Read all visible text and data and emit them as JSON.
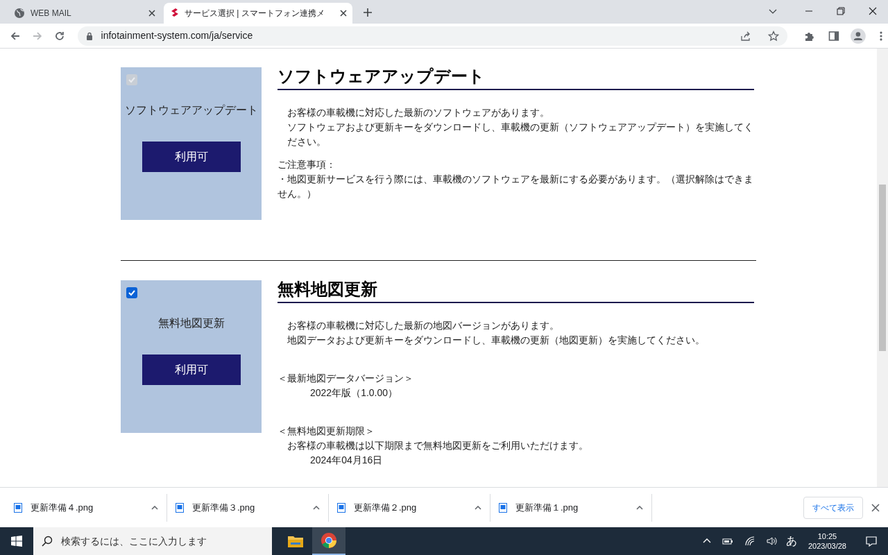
{
  "browser": {
    "tabs": [
      {
        "title": "WEB MAIL",
        "selected": false
      },
      {
        "title": "サービス選択 | スマートフォン連携メ",
        "selected": true
      }
    ],
    "url": "infotainment-system.com/ja/service"
  },
  "services": [
    {
      "card_label": "ソフトウェアアップデート",
      "checked": true,
      "disabled": true,
      "status_button": "利用可",
      "title": "ソフトウェアアップデート",
      "paragraphs": [
        [
          {
            "kind": "lead",
            "text": "お客様の車載機に対応した最新のソフトウェアがあります。"
          },
          {
            "kind": "lead",
            "text": "ソフトウェアおよび更新キーをダウンロードし、車載機の更新（ソフトウェアアップデート）を実施してください。"
          }
        ],
        [
          {
            "kind": "plain",
            "text": "ご注意事項："
          },
          {
            "kind": "plain",
            "text": "・地図更新サービスを行う際には、車載機のソフトウェアを最新にする必要があります。（選択解除はできません。）"
          }
        ]
      ]
    },
    {
      "card_label": "無料地図更新",
      "checked": true,
      "disabled": false,
      "status_button": "利用可",
      "title": "無料地図更新",
      "paragraphs": [
        [
          {
            "kind": "lead",
            "text": "お客様の車載機に対応した最新の地図バージョンがあります。"
          },
          {
            "kind": "lead",
            "text": "地図データおよび更新キーをダウンロードし、車載機の更新（地図更新）を実施してください。"
          }
        ],
        [
          {
            "kind": "plain",
            "text": "＜最新地図データバージョン＞"
          },
          {
            "kind": "value",
            "text": "2022年版（1.0.00）"
          }
        ],
        [
          {
            "kind": "plain",
            "text": "＜無料地図更新期限＞"
          },
          {
            "kind": "lead",
            "text": "お客様の車載機は以下期限まで無料地図更新をご利用いただけます。"
          },
          {
            "kind": "value",
            "text": "2024年04月16日"
          }
        ]
      ]
    }
  ],
  "downloads": {
    "files": [
      "更新準備４.png",
      "更新準備３.png",
      "更新準備２.png",
      "更新準備１.png"
    ],
    "show_all": "すべて表示"
  },
  "taskbar": {
    "search_placeholder": "検索するには、ここに入力します",
    "ime": "あ",
    "time": "10:25",
    "date": "2023/03/28"
  }
}
